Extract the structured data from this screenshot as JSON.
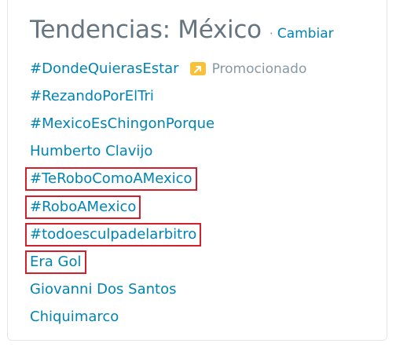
{
  "header": {
    "title": "Tendencias: México",
    "separator": "·",
    "change_label": "Cambiar"
  },
  "trends": [
    {
      "label": "#DondeQuierasEstar",
      "promoted": true,
      "promo_label": "Promocionado",
      "highlighted": false
    },
    {
      "label": "#RezandoPorElTri",
      "promoted": false,
      "highlighted": false
    },
    {
      "label": "#MexicoEsChingonPorque",
      "promoted": false,
      "highlighted": false
    },
    {
      "label": "Humberto Clavijo",
      "promoted": false,
      "highlighted": false
    },
    {
      "label": "#TeRoboComoAMexico",
      "promoted": false,
      "highlighted": true
    },
    {
      "label": "#RoboAMexico",
      "promoted": false,
      "highlighted": true
    },
    {
      "label": "#todoesculpadelarbitro",
      "promoted": false,
      "highlighted": true
    },
    {
      "label": "Era Gol",
      "promoted": false,
      "highlighted": true
    },
    {
      "label": "Giovanni Dos Santos",
      "promoted": false,
      "highlighted": false
    },
    {
      "label": "Chiquimarco",
      "promoted": false,
      "highlighted": false
    }
  ],
  "colors": {
    "title": "#66757f",
    "link": "#0084b4",
    "promo_icon": "#f9c13a",
    "promo_text": "#8899a6",
    "highlight_border": "#d0202e",
    "card_border": "#e1e8ed"
  },
  "icons": {
    "promoted": "promoted-arrow-icon"
  }
}
